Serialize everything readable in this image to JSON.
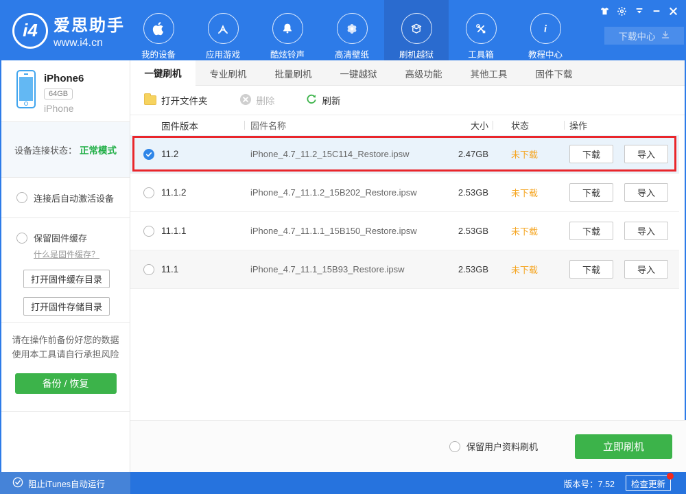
{
  "header": {
    "logo": {
      "badge": "i4",
      "title": "爱思助手",
      "subtitle": "www.i4.cn"
    },
    "nav": [
      {
        "label": "我的设备",
        "icon": "apple-icon",
        "active": false
      },
      {
        "label": "应用游戏",
        "icon": "appstore-icon",
        "active": false
      },
      {
        "label": "酷炫铃声",
        "icon": "bell-icon",
        "active": false
      },
      {
        "label": "高清壁纸",
        "icon": "wallpaper-icon",
        "active": false
      },
      {
        "label": "刷机越狱",
        "icon": "flash-jailbreak-icon",
        "active": true
      },
      {
        "label": "工具箱",
        "icon": "toolbox-icon",
        "active": false
      },
      {
        "label": "教程中心",
        "icon": "tutorial-info-icon",
        "active": false
      }
    ],
    "window_controls": [
      "skin-icon",
      "settings-gear-icon",
      "menu-icon",
      "minimize-icon",
      "close-icon"
    ],
    "download_center_label": "下载中心"
  },
  "sidebar": {
    "device": {
      "name": "iPhone6",
      "capacity": "64GB",
      "model": "iPhone"
    },
    "status_label": "设备连接状态：",
    "status_value": "正常模式",
    "options": [
      {
        "label": "连接后自动激活设备",
        "checked": false
      },
      {
        "label": "保留固件缓存",
        "checked": false
      }
    ],
    "cache_link": "什么是固件缓存？",
    "dir_buttons": [
      "打开固件缓存目录",
      "打开固件存储目录"
    ],
    "warning_line1": "请在操作前备份好您的数据",
    "warning_line2": "使用本工具请自行承担风险",
    "backup_button": "备份 / 恢复",
    "footer_label": "阻止iTunes自动运行"
  },
  "tabs": [
    {
      "label": "一键刷机",
      "active": true
    },
    {
      "label": "专业刷机",
      "active": false
    },
    {
      "label": "批量刷机",
      "active": false
    },
    {
      "label": "一键越狱",
      "active": false
    },
    {
      "label": "高级功能",
      "active": false
    },
    {
      "label": "其他工具",
      "active": false
    },
    {
      "label": "固件下载",
      "active": false
    }
  ],
  "toolbar": {
    "open_folder": "打开文件夹",
    "delete": "删除",
    "refresh": "刷新"
  },
  "table": {
    "columns": [
      "固件版本",
      "固件名称",
      "大小",
      "状态",
      "操作"
    ],
    "download_label": "下载",
    "import_label": "导入",
    "rows": [
      {
        "version": "11.2",
        "filename": "iPhone_4.7_11.2_15C114_Restore.ipsw",
        "size": "2.47GB",
        "status": "未下载",
        "selected": true,
        "highlighted": true
      },
      {
        "version": "11.1.2",
        "filename": "iPhone_4.7_11.1.2_15B202_Restore.ipsw",
        "size": "2.53GB",
        "status": "未下载",
        "selected": false,
        "highlighted": false
      },
      {
        "version": "11.1.1",
        "filename": "iPhone_4.7_11.1.1_15B150_Restore.ipsw",
        "size": "2.53GB",
        "status": "未下载",
        "selected": false,
        "highlighted": false
      },
      {
        "version": "11.1",
        "filename": "iPhone_4.7_11.1_15B93_Restore.ipsw",
        "size": "2.53GB",
        "status": "未下载",
        "selected": false,
        "highlighted": false
      }
    ]
  },
  "flash_panel": {
    "keep_data_label": "保留用户资料刷机",
    "flash_button": "立即刷机"
  },
  "statusbar": {
    "version_label": "版本号：7.52",
    "update_button": "检查更新",
    "update_badge": true
  },
  "colors": {
    "header_blue": "#2D7BE8",
    "active_nav_blue": "#2A6BCF",
    "footer_left_blue": "#4583D8",
    "footer_right_blue": "#2673DE",
    "accent_green": "#3CB34A",
    "status_green": "#1CAD42",
    "warning_orange": "#F5A623",
    "annotation_red": "#E9262B",
    "selected_row_bg": "#EAF3FB",
    "device_icon_blue": "#41A5EE"
  }
}
